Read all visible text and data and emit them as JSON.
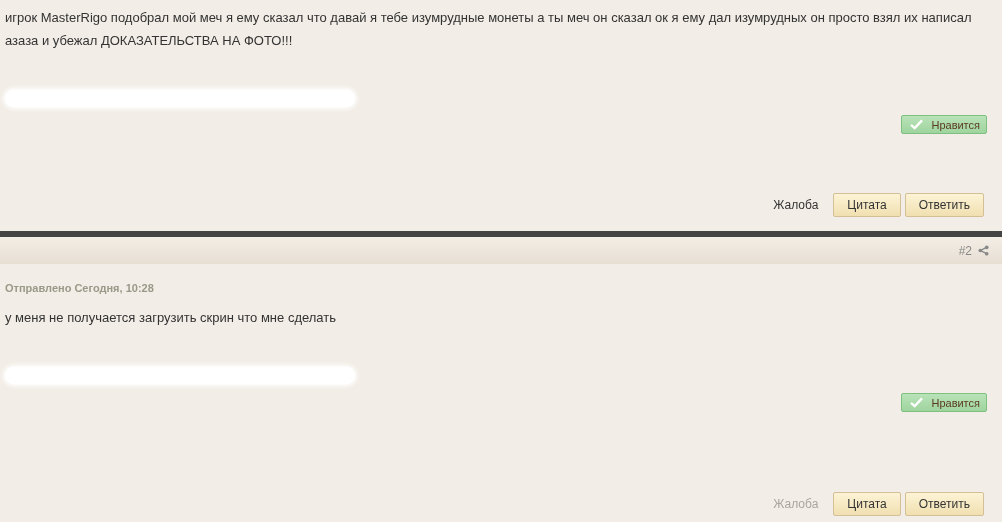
{
  "posts": [
    {
      "text": "игрок MasterRigo подобрал мой меч я ему сказал что давай я тебе изумрудные монеты а ты меч он сказал ок я ему дал изумрудных он просто взял их написал азаза и убежал ДОКАЗАТЕЛЬСТВА НА ФОТО!!!",
      "signature_redacted": true,
      "like": "Нравится",
      "report": {
        "label": "Жалоба",
        "disabled": false
      },
      "quote": "Цитата",
      "reply": "Ответить"
    },
    {
      "header": {
        "number": "#2"
      },
      "meta": "Отправлено Сегодня, 10:28",
      "text": "у меня не получается загрузить скрин что мне сделать",
      "signature_redacted": true,
      "like": "Нравится",
      "report": {
        "label": "Жалоба",
        "disabled": true
      },
      "quote": "Цитата",
      "reply": "Ответить"
    }
  ]
}
